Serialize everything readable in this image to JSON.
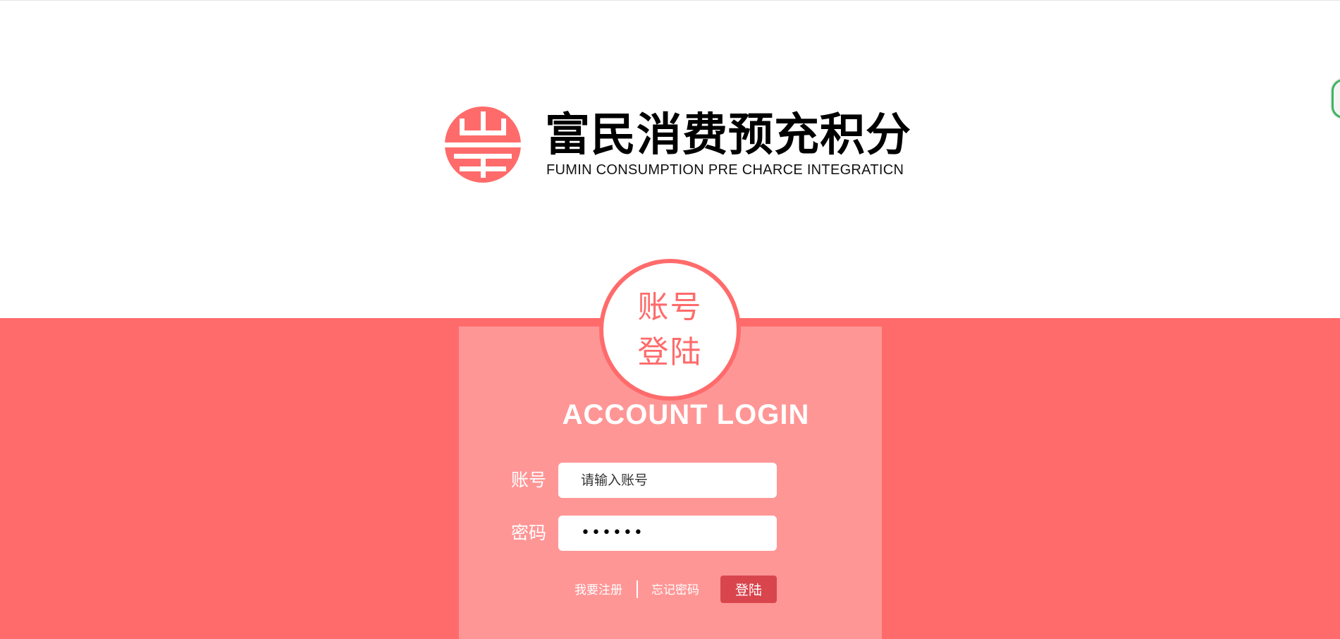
{
  "brand": {
    "title": "富民消费预充积分",
    "subtitle": "FUMIN CONSUMPTION PRE CHARCE INTEGRATICN",
    "logo_icon": "fumin-logo-icon",
    "logo_color": "#ff6b6b"
  },
  "login": {
    "badge_line1": "账号",
    "badge_line2": "登陆",
    "heading": "ACCOUNT LOGIN",
    "account_label": "账号",
    "account_placeholder": "请输入账号",
    "password_label": "密码",
    "password_value": "••••••",
    "register_link": "我要注册",
    "forgot_link": "忘记密码",
    "submit_label": "登陆"
  },
  "colors": {
    "accent": "#ff6b6b",
    "panel": "#ff9696",
    "button": "#d9454d"
  }
}
